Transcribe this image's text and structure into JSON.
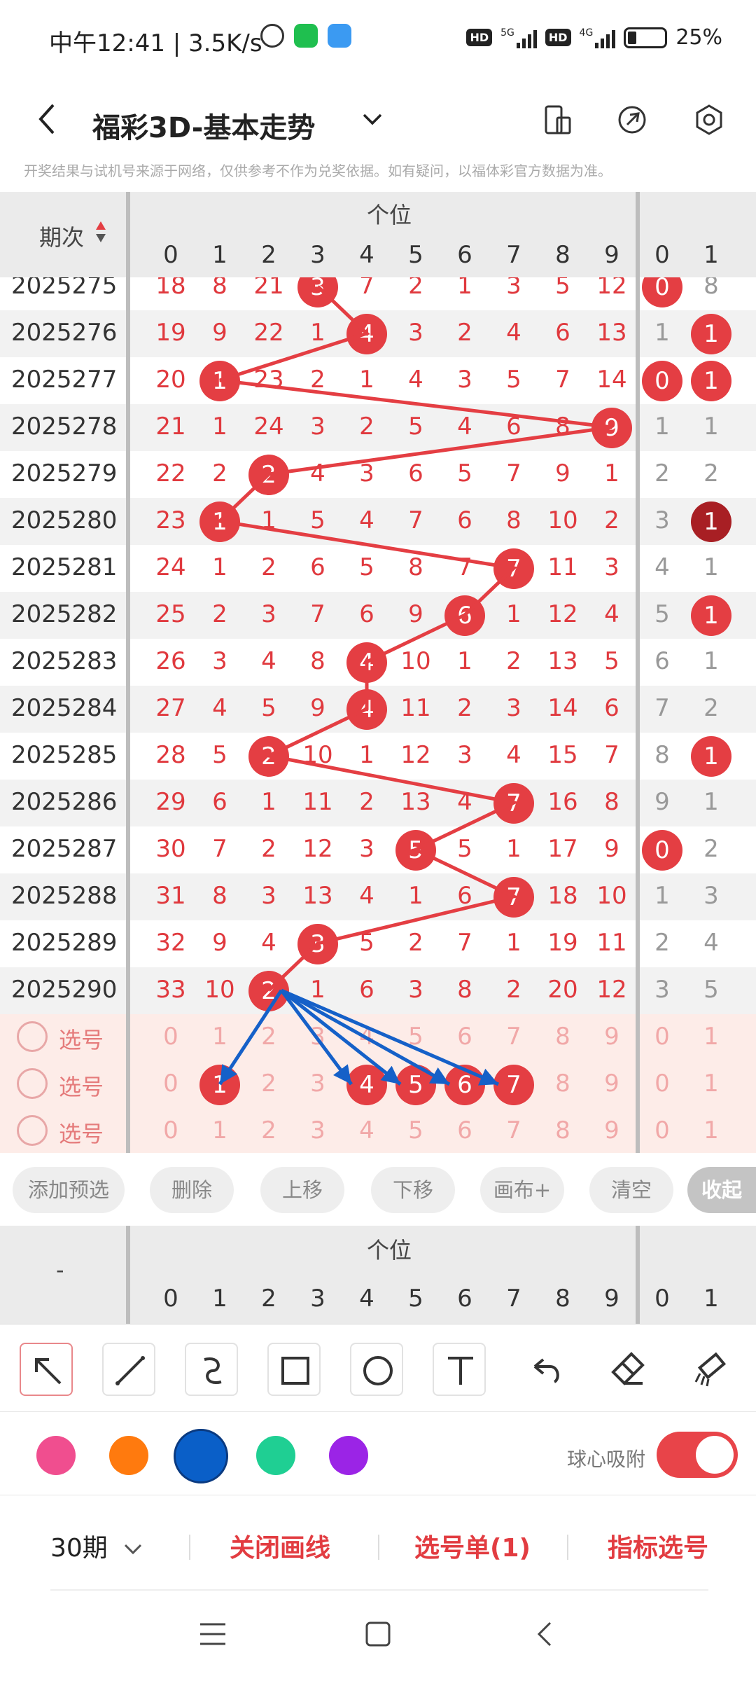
{
  "status": {
    "time": "中午12:41 | 3.5K/s",
    "hd1": "HD",
    "sig1": "5G",
    "hd2": "HD",
    "sig2": "4G",
    "battery": "25%"
  },
  "nav": {
    "title": "福彩3D-基本走势"
  },
  "notice": "开奖结果与试机号来源于网络，仅供参考不作为兑奖依据。如有疑问，以福体彩官方数据为准。",
  "table": {
    "period_header": "期次",
    "group_label": "个位",
    "digits": [
      "0",
      "1",
      "2",
      "3",
      "4",
      "5",
      "6",
      "7",
      "8",
      "9",
      "0",
      "1"
    ],
    "rows": [
      {
        "period": "2025275",
        "cells": [
          "18",
          "8",
          "21",
          "3",
          "7",
          "2",
          "1",
          "3",
          "5",
          "12",
          "0",
          "8"
        ]
      },
      {
        "period": "2025276",
        "cells": [
          "19",
          "9",
          "22",
          "1",
          "4",
          "3",
          "2",
          "4",
          "6",
          "13",
          "1",
          "1"
        ]
      },
      {
        "period": "2025277",
        "cells": [
          "20",
          "1",
          "23",
          "2",
          "1",
          "4",
          "3",
          "5",
          "7",
          "14",
          "0",
          "1"
        ]
      },
      {
        "period": "2025278",
        "cells": [
          "21",
          "1",
          "24",
          "3",
          "2",
          "5",
          "4",
          "6",
          "8",
          "9",
          "1",
          "1"
        ]
      },
      {
        "period": "2025279",
        "cells": [
          "22",
          "2",
          "2",
          "4",
          "3",
          "6",
          "5",
          "7",
          "9",
          "1",
          "2",
          "2"
        ]
      },
      {
        "period": "2025280",
        "cells": [
          "23",
          "1",
          "1",
          "5",
          "4",
          "7",
          "6",
          "8",
          "10",
          "2",
          "3",
          "1"
        ]
      },
      {
        "period": "2025281",
        "cells": [
          "24",
          "1",
          "2",
          "6",
          "5",
          "8",
          "7",
          "7",
          "11",
          "3",
          "4",
          "1"
        ]
      },
      {
        "period": "2025282",
        "cells": [
          "25",
          "2",
          "3",
          "7",
          "6",
          "9",
          "6",
          "1",
          "12",
          "4",
          "5",
          "1"
        ]
      },
      {
        "period": "2025283",
        "cells": [
          "26",
          "3",
          "4",
          "8",
          "4",
          "10",
          "1",
          "2",
          "13",
          "5",
          "6",
          "1"
        ]
      },
      {
        "period": "2025284",
        "cells": [
          "27",
          "4",
          "5",
          "9",
          "4",
          "11",
          "2",
          "3",
          "14",
          "6",
          "7",
          "2"
        ]
      },
      {
        "period": "2025285",
        "cells": [
          "28",
          "5",
          "2",
          "10",
          "1",
          "12",
          "3",
          "4",
          "15",
          "7",
          "8",
          "1"
        ]
      },
      {
        "period": "2025286",
        "cells": [
          "29",
          "6",
          "1",
          "11",
          "2",
          "13",
          "4",
          "7",
          "16",
          "8",
          "9",
          "1"
        ]
      },
      {
        "period": "2025287",
        "cells": [
          "30",
          "7",
          "2",
          "12",
          "3",
          "5",
          "5",
          "1",
          "17",
          "9",
          "0",
          "2"
        ]
      },
      {
        "period": "2025288",
        "cells": [
          "31",
          "8",
          "3",
          "13",
          "4",
          "1",
          "6",
          "7",
          "18",
          "10",
          "1",
          "3"
        ]
      },
      {
        "period": "2025289",
        "cells": [
          "32",
          "9",
          "4",
          "3",
          "5",
          "2",
          "7",
          "1",
          "19",
          "11",
          "2",
          "4"
        ]
      },
      {
        "period": "2025290",
        "cells": [
          "33",
          "10",
          "2",
          "1",
          "6",
          "3",
          "8",
          "2",
          "20",
          "12",
          "3",
          "5"
        ]
      }
    ],
    "pick_rows": [
      {
        "label": "选号",
        "cells": [
          "0",
          "1",
          "2",
          "3",
          "4",
          "5",
          "6",
          "7",
          "8",
          "9",
          "0",
          "1"
        ]
      },
      {
        "label": "选号",
        "cells": [
          "0",
          "1",
          "2",
          "3",
          "4",
          "5",
          "6",
          "7",
          "8",
          "9",
          "0",
          "1"
        ]
      },
      {
        "label": "选号",
        "cells": [
          "0",
          "1",
          "2",
          "3",
          "4",
          "5",
          "6",
          "7",
          "8",
          "9",
          "0",
          "1"
        ]
      }
    ]
  },
  "actions": [
    "添加预选",
    "删除",
    "上移",
    "下移",
    "画布+",
    "清空",
    "收起"
  ],
  "second_header": {
    "label": "-",
    "group_label": "个位"
  },
  "tools": [
    "pointer-icon",
    "line-icon",
    "curve-icon",
    "rectangle-icon",
    "circle-icon",
    "text-icon",
    "undo-icon",
    "eraser-icon",
    "clear-icon"
  ],
  "colors": [
    "#f04e8f",
    "#ff7a0e",
    "#0a5fc8",
    "#1fcf93",
    "#9b24e6"
  ],
  "snap_label": "球心吸附",
  "bottom": {
    "period": "30期",
    "close_line": "关闭画线",
    "pick_list": "选号单(1)",
    "indicator": "指标选号"
  }
}
